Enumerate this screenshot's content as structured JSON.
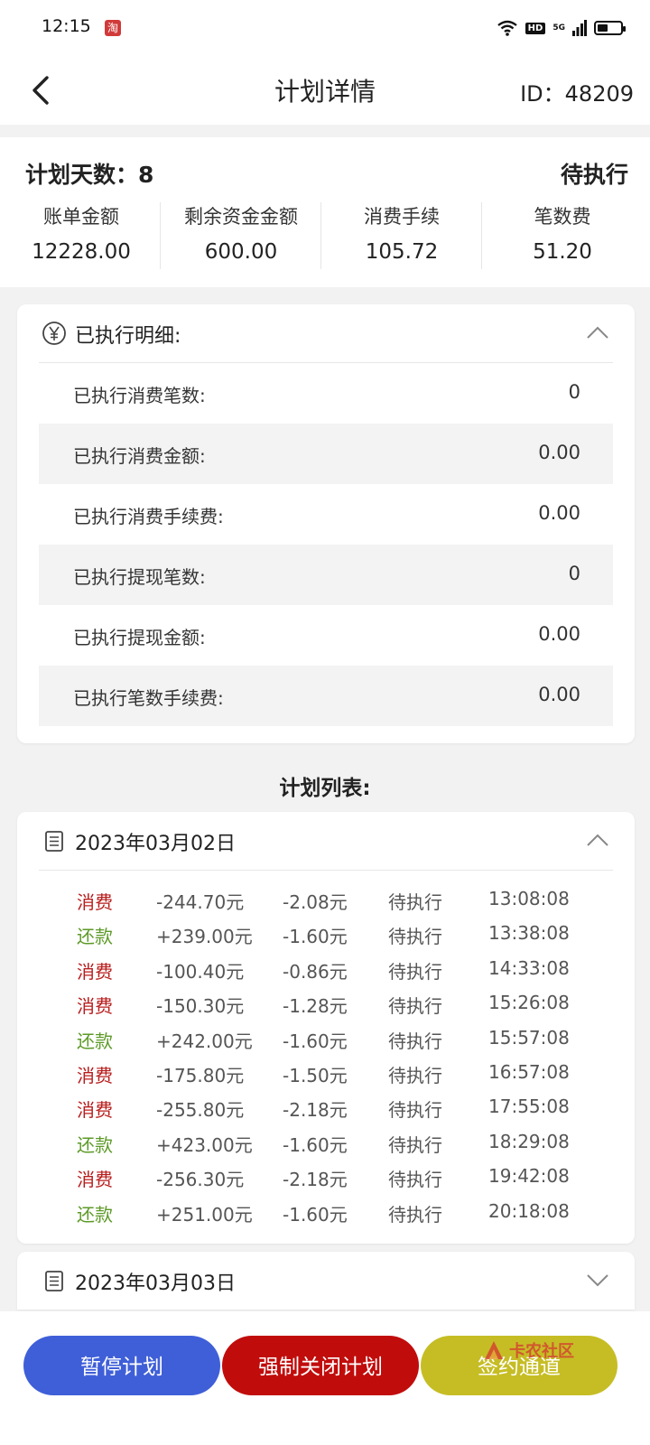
{
  "status_bar": {
    "time": "12:15",
    "taobao_glyph": "淘",
    "hd": "HD",
    "network": "5G",
    "battery_level": 0.45
  },
  "header": {
    "title": "计划详情",
    "id_text": "ID：48209"
  },
  "summary": {
    "days_text": "计划天数：8",
    "status": "待执行",
    "stats": [
      {
        "label": "账单金额",
        "value": "12228.00"
      },
      {
        "label": "剩余资金金额",
        "value": "600.00"
      },
      {
        "label": "消费手续",
        "value": "105.72"
      },
      {
        "label": "笔数费",
        "value": "51.20"
      }
    ]
  },
  "executed": {
    "title": "已执行明细:",
    "icon": "yen-circle-icon",
    "rows": [
      {
        "label": "已执行消费笔数:",
        "value": "0"
      },
      {
        "label": "已执行消费金额:",
        "value": "0.00"
      },
      {
        "label": "已执行消费手续费:",
        "value": "0.00"
      },
      {
        "label": "已执行提现笔数:",
        "value": "0"
      },
      {
        "label": "已执行提现金额:",
        "value": "0.00"
      },
      {
        "label": "已执行笔数手续费:",
        "value": "0.00"
      }
    ]
  },
  "plan_list": {
    "title": "计划列表:",
    "days": [
      {
        "date": "2023年03月02日",
        "expanded": true,
        "transactions": [
          {
            "type": "消费",
            "amount": "-244.70元",
            "fee": "-2.08元",
            "status": "待执行",
            "time": "13:08:08"
          },
          {
            "type": "还款",
            "amount": "+239.00元",
            "fee": "-1.60元",
            "status": "待执行",
            "time": "13:38:08"
          },
          {
            "type": "消费",
            "amount": "-100.40元",
            "fee": "-0.86元",
            "status": "待执行",
            "time": "14:33:08"
          },
          {
            "type": "消费",
            "amount": "-150.30元",
            "fee": "-1.28元",
            "status": "待执行",
            "time": "15:26:08"
          },
          {
            "type": "还款",
            "amount": "+242.00元",
            "fee": "-1.60元",
            "status": "待执行",
            "time": "15:57:08"
          },
          {
            "type": "消费",
            "amount": "-175.80元",
            "fee": "-1.50元",
            "status": "待执行",
            "time": "16:57:08"
          },
          {
            "type": "消费",
            "amount": "-255.80元",
            "fee": "-2.18元",
            "status": "待执行",
            "time": "17:55:08"
          },
          {
            "type": "还款",
            "amount": "+423.00元",
            "fee": "-1.60元",
            "status": "待执行",
            "time": "18:29:08"
          },
          {
            "type": "消费",
            "amount": "-256.30元",
            "fee": "-2.18元",
            "status": "待执行",
            "time": "19:42:08"
          },
          {
            "type": "还款",
            "amount": "+251.00元",
            "fee": "-1.60元",
            "status": "待执行",
            "time": "20:18:08"
          }
        ]
      },
      {
        "date": "2023年03月03日",
        "expanded": false,
        "transactions": []
      }
    ]
  },
  "buttons": {
    "pause": "暂停计划",
    "force_close": "强制关闭计划",
    "channel": "签约通道"
  },
  "watermark": {
    "text": "卡农社区"
  },
  "colors": {
    "spend": "#b81c1c",
    "repay": "#5d9a27",
    "pause_button": "#3f5fd8",
    "close_button": "#c10c0c",
    "channel_button": "#c6bd25"
  }
}
